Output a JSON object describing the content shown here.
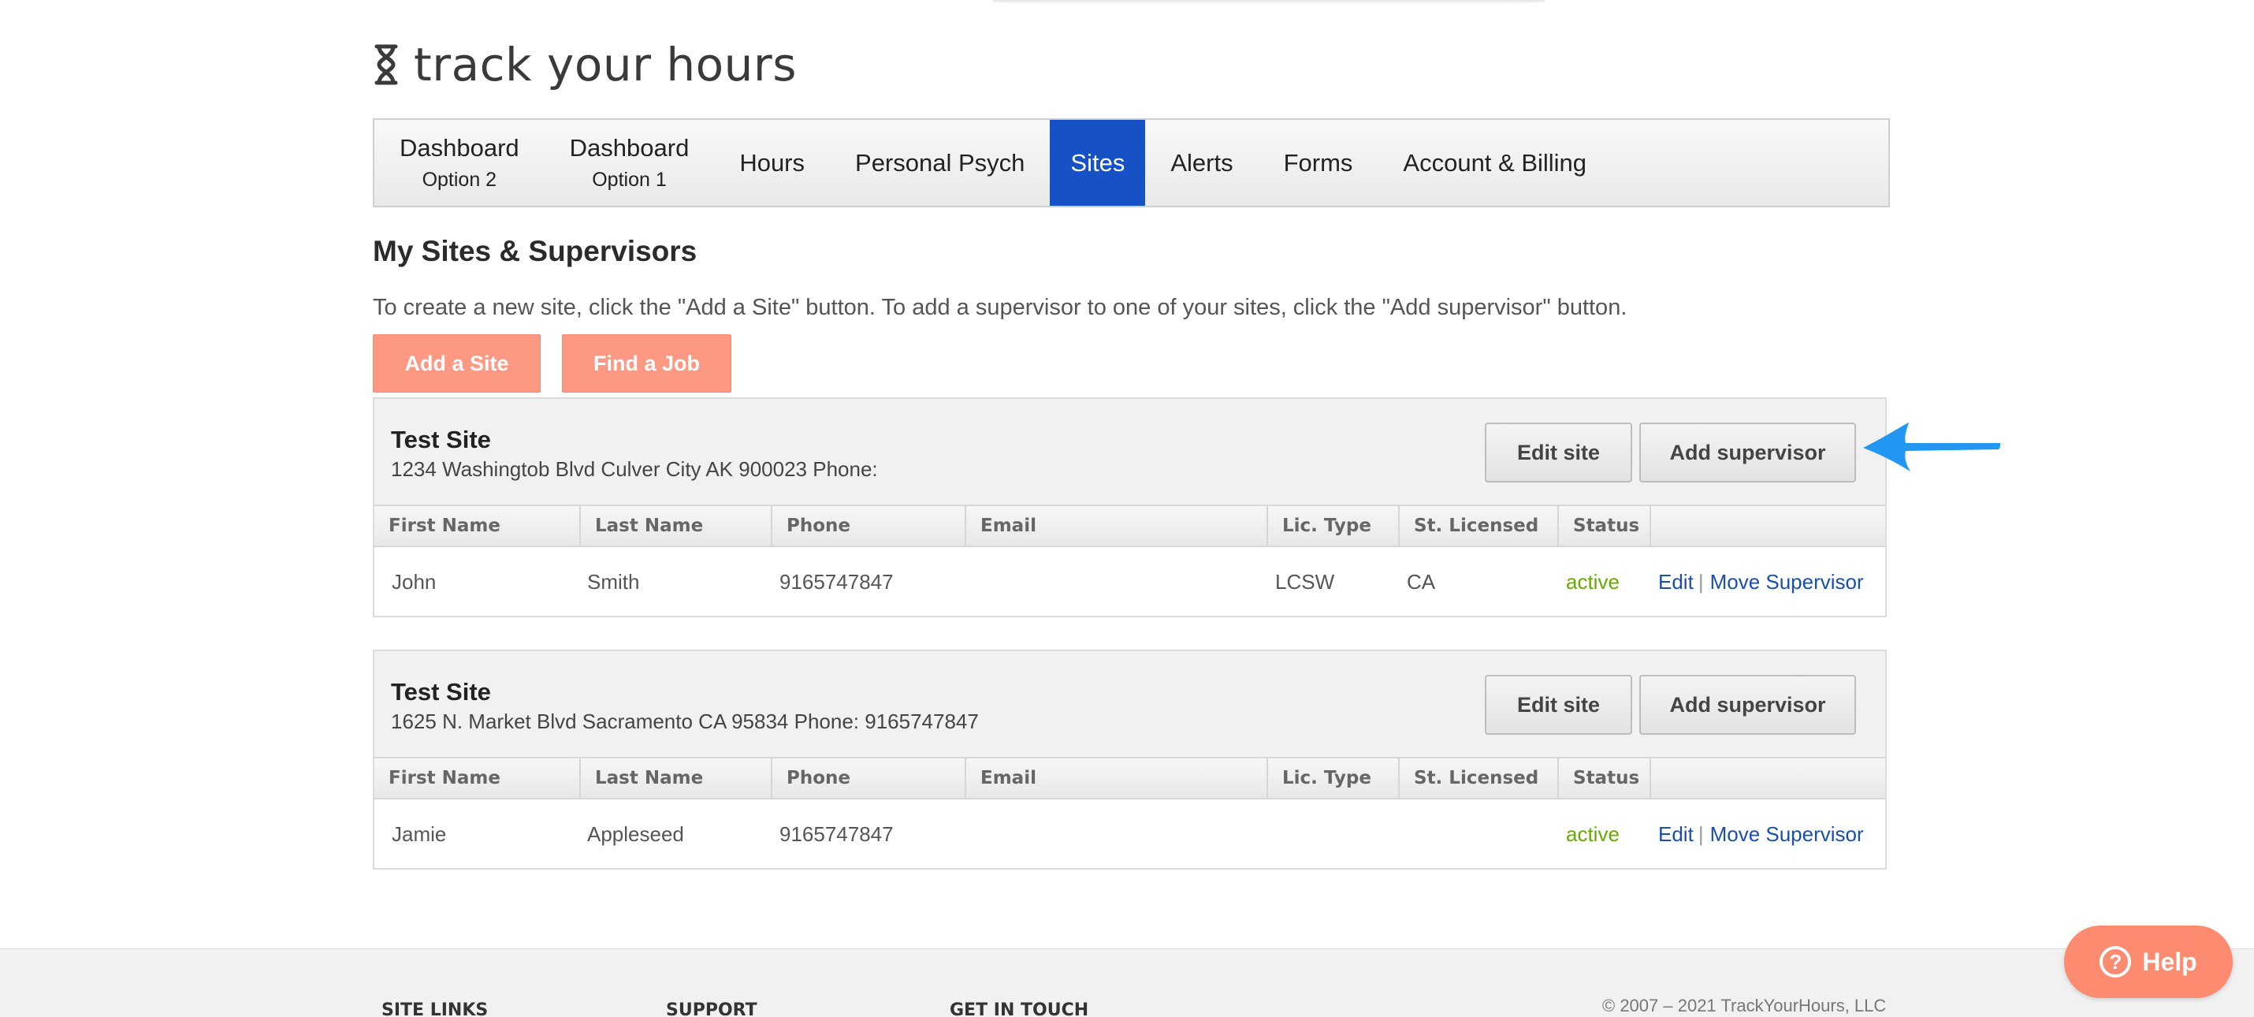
{
  "brand": {
    "name": "track your hours",
    "icon": "hourglass-icon"
  },
  "nav": {
    "items": [
      {
        "label": "Dashboard",
        "sub": "Option 2"
      },
      {
        "label": "Dashboard",
        "sub": "Option 1"
      },
      {
        "label": "Hours"
      },
      {
        "label": "Personal Psych"
      },
      {
        "label": "Sites",
        "active": true
      },
      {
        "label": "Alerts"
      },
      {
        "label": "Forms"
      },
      {
        "label": "Account & Billing"
      }
    ],
    "active_color": "#1651c5"
  },
  "page": {
    "title": "My Sites & Supervisors",
    "intro": "To create a new site, click the \"Add a Site\" button. To add a supervisor to one of your sites, click the \"Add supervisor\" button.",
    "add_site_label": "Add a Site",
    "find_job_label": "Find a Job",
    "accent_color": "#fd9883"
  },
  "table_headers": [
    "First Name",
    "Last Name",
    "Phone",
    "Email",
    "Lic. Type",
    "St. Licensed",
    "Status"
  ],
  "sites": [
    {
      "name": "Test Site",
      "address": "1234 Washingtob Blvd Culver City AK 900023 Phone:",
      "edit_label": "Edit site",
      "add_supervisor_label": "Add supervisor",
      "supervisors": [
        {
          "first": "John",
          "last": "Smith",
          "phone": "9165747847",
          "email": "",
          "lic": "LCSW",
          "state": "CA",
          "status": "active",
          "edit": "Edit",
          "move": "Move Supervisor"
        }
      ]
    },
    {
      "name": "Test Site",
      "address": "1625 N. Market Blvd Sacramento CA 95834 Phone: 9165747847",
      "edit_label": "Edit site",
      "add_supervisor_label": "Add supervisor",
      "supervisors": [
        {
          "first": "Jamie",
          "last": "Appleseed",
          "phone": "9165747847",
          "email": "",
          "lic": "",
          "state": "",
          "status": "active",
          "edit": "Edit",
          "move": "Move Supervisor"
        }
      ]
    }
  ],
  "footer": {
    "site_links": "SITE LINKS",
    "support": "SUPPORT",
    "get_in_touch": "GET IN TOUCH",
    "copyright": "© 2007 – 2021 TrackYourHours, LLC"
  },
  "help": {
    "label": "Help",
    "icon": "question-circle-icon",
    "color": "#fd8b70"
  },
  "annotation": {
    "icon": "blue-arrow-icon",
    "color": "#2196f3"
  }
}
